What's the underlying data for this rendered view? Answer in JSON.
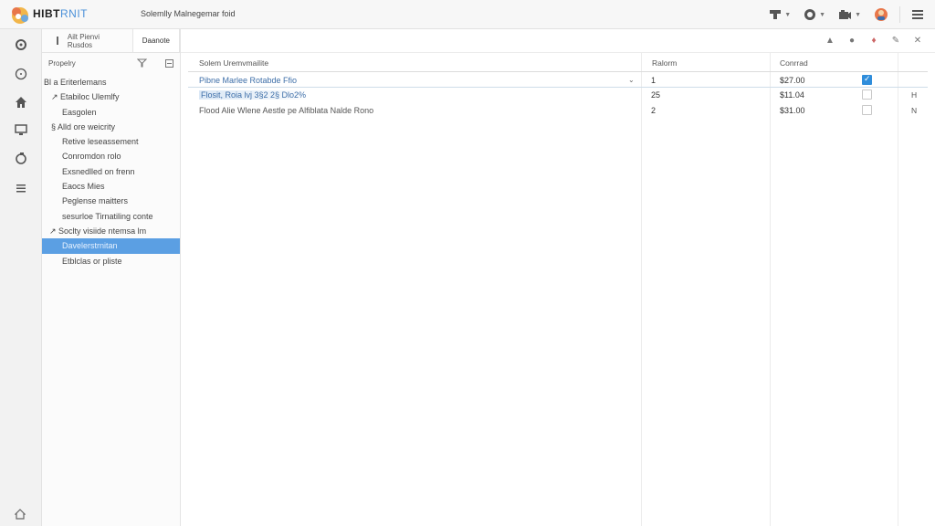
{
  "header": {
    "brand_main": "HIBT",
    "brand_accent": "RNIT",
    "title": "Solemlly Malnegemar foid",
    "icons": [
      "terminal-icon",
      "clock-icon",
      "camera-icon",
      "avatar-icon",
      "hamburger-icon"
    ]
  },
  "rail": {
    "icons": [
      "settings-icon",
      "circle-icon",
      "home-icon",
      "monitor-icon",
      "sync-icon",
      "list-icon"
    ],
    "footer_icon": "home-outline-icon"
  },
  "tree": {
    "tabs": [
      "Ailt Pienvi Rusdos",
      "Daanote"
    ],
    "header_label": "Propelry",
    "items": [
      {
        "label": "Bl a  Eriterlemans",
        "indent": 2
      },
      {
        "label": "↗ Etabiloc Ulemlfy",
        "indent": 10
      },
      {
        "label": "Easgolen",
        "indent": 22
      },
      {
        "label": "§ Alld ore weicrity",
        "indent": 10
      },
      {
        "label": "Retive leseassement",
        "indent": 22
      },
      {
        "label": "Conromdon rolo",
        "indent": 22
      },
      {
        "label": "Exsnedlled on frenn",
        "indent": 22
      },
      {
        "label": "Eaocs Mies",
        "indent": 22
      },
      {
        "label": "Peglense maitters",
        "indent": 22
      },
      {
        "label": "sesurloe Tirnatiling conte",
        "indent": 22
      },
      {
        "label": "↗ Soclty visiide ntemsa lm",
        "indent": 8
      },
      {
        "label": "Davelerstrnitan",
        "indent": 22,
        "selected": true
      },
      {
        "label": "Etblclas or pliste",
        "indent": 22
      }
    ]
  },
  "table": {
    "columns": [
      "Solem Uremvmailite",
      "Ralorm",
      "Conrrad"
    ],
    "rows": [
      {
        "name": "Pibne Marlee Rotabde Ffio",
        "qty": "1",
        "price": "$27.00",
        "checked": true,
        "flag": ""
      },
      {
        "name": "Flosit, Roia lvj 3§2 2§ Dlo2%",
        "qty": "25",
        "price": "$11.04",
        "checked": false,
        "flag": "H"
      },
      {
        "name": "Flood Alie Wlene Aestle pe Alfiblata Nalde Rono",
        "qty": "2",
        "price": "$31.00",
        "checked": false,
        "flag": "N"
      }
    ]
  },
  "colors": {
    "accent": "#4a90d9",
    "selected": "#5b9fe3",
    "checkbox": "#2f8ddb"
  }
}
